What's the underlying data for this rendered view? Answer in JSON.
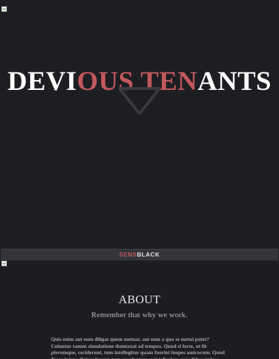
{
  "hero": {
    "title_parts": [
      {
        "text": "DEVI",
        "highlight": false
      },
      {
        "text": "OUS",
        "highlight": true
      },
      {
        "text": " TEN",
        "highlight": true
      },
      {
        "text": "ANTS",
        "highlight": false
      }
    ],
    "arrow_icon": "down-triangle-outline-icon",
    "broken_image_icon": "broken-image-icon"
  },
  "brand": {
    "part1": "SENS",
    "part2": "BLACK"
  },
  "about": {
    "title": "ABOUT",
    "subtitle": "Remember that why we work.",
    "body": "Quis enim aut eum diligat quem metuat, aut eum a quo se metui putet? Coluntur tamen simulatione dumtaxat ad tempus. Quod si forte, ut fit plerumque, ceciderunt, tum intellegitur quam fuerint inopes amicorum. Quod Tarquinium dixisse ferunt, tum exsulantem se intellexisse quos fidos amicos habuisset, quos"
  },
  "colors": {
    "background": "#1c1d20",
    "accent": "#c0585c",
    "bar": "#34363c",
    "text": "#ffffff"
  }
}
